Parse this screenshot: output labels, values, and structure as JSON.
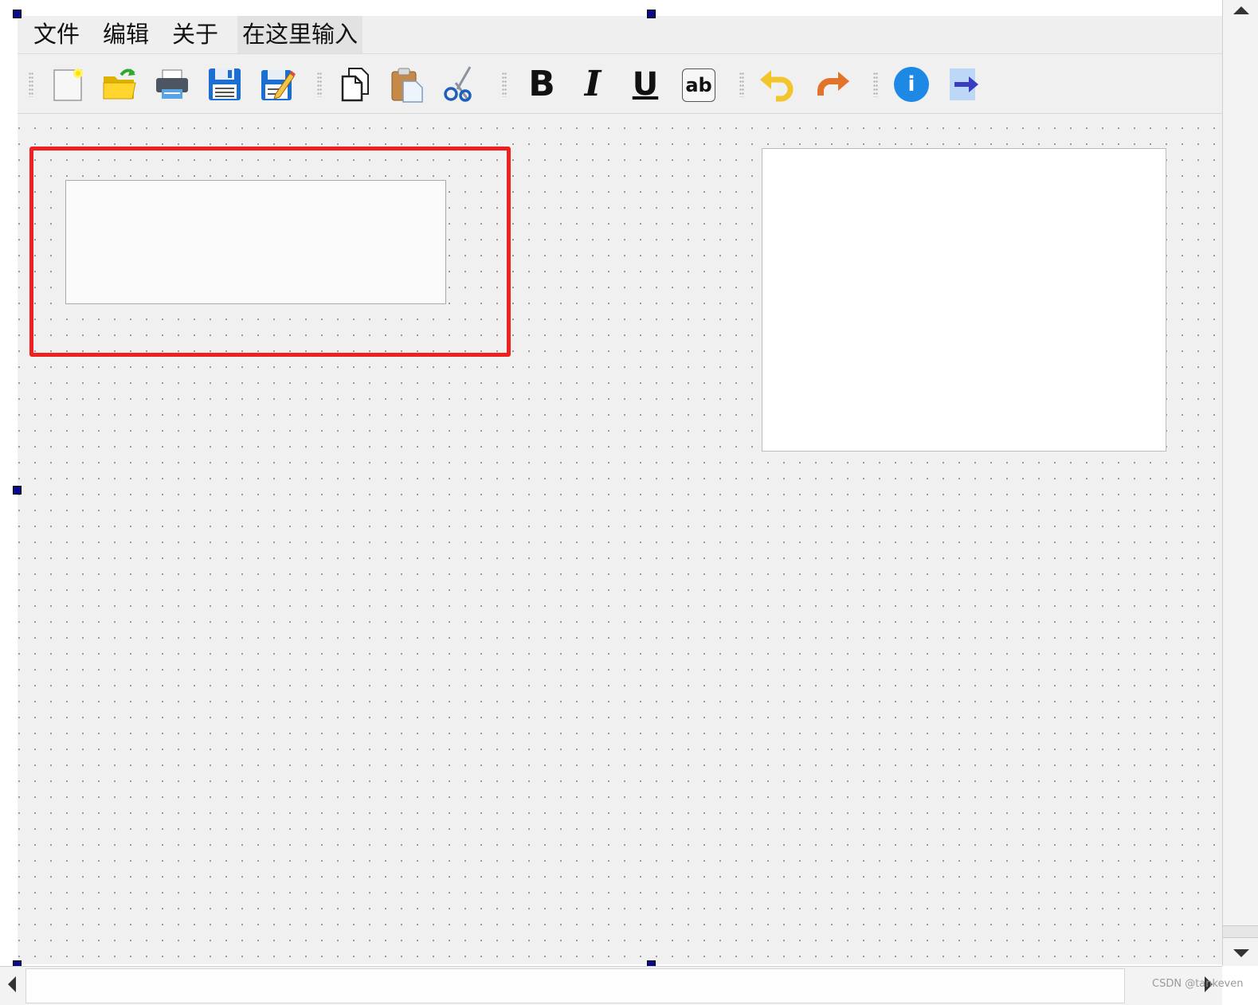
{
  "menubar": {
    "items": [
      {
        "label": "文件"
      },
      {
        "label": "编辑"
      },
      {
        "label": "关于"
      },
      {
        "label": "在这里输入"
      }
    ]
  },
  "toolbar": {
    "bold_label": "B",
    "italic_label": "I",
    "underline_label": "U",
    "font_icon_label": "ab",
    "info_label": "i",
    "icons": [
      "new-file-icon",
      "open-folder-icon",
      "print-icon",
      "save-icon",
      "save-as-icon",
      "copy-icon",
      "paste-icon",
      "cut-icon",
      "bold-icon",
      "italic-icon",
      "underline-icon",
      "font-icon",
      "undo-icon",
      "redo-icon",
      "info-icon",
      "exit-arrow-icon"
    ]
  },
  "watermark": "CSDN @tankeven",
  "colors": {
    "highlight": "#ee2020",
    "info": "#1e88e5",
    "selection_handle": "#0a0a8a",
    "undo": "#f2c52b",
    "redo": "#e2732a"
  }
}
